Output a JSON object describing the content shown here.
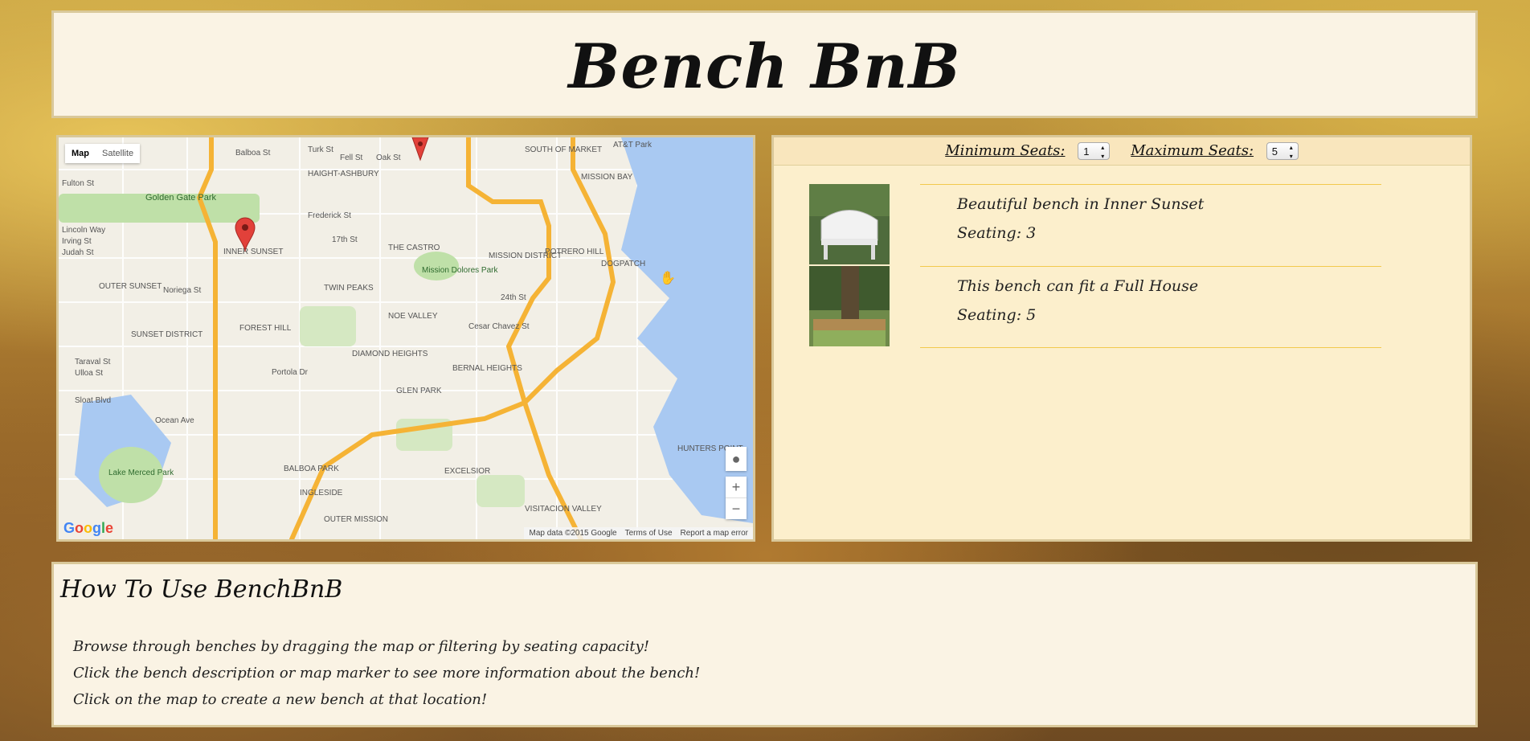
{
  "header": {
    "title": "Bench BnB"
  },
  "map": {
    "type_buttons": [
      "Map",
      "Satellite"
    ],
    "zoom_in": "+",
    "zoom_out": "−",
    "attribution": [
      "Map data ©2015 Google",
      "Terms of Use",
      "Report a map error"
    ],
    "logo": "Google",
    "labels": [
      "Balboa St",
      "Turk St",
      "Fulton St",
      "Golden Gate Park",
      "HAIGHT-ASHBURY",
      "Fell St",
      "Oak St",
      "Frederick St",
      "17th St",
      "Lincoln Way",
      "Irving St",
      "Judah St",
      "INNER SUNSET",
      "THE CASTRO",
      "MISSION DISTRICT",
      "POTRERO HILL",
      "DOGPATCH",
      "Mission Dolores Park",
      "OUTER SUNSET",
      "Noriega St",
      "TWIN PEAKS",
      "NOE VALLEY",
      "24th St",
      "Cesar Chavez St",
      "SUNSET DISTRICT",
      "FOREST HILL",
      "DIAMOND HEIGHTS",
      "BERNAL HEIGHTS",
      "Taraval St",
      "Ulloa St",
      "Portola Dr",
      "GLEN PARK",
      "Sloat Blvd",
      "Ocean Ave",
      "Lake Merced Park",
      "BALBOA PARK",
      "EXCELSIOR",
      "INGLESIDE",
      "OUTER MISSION",
      "VISITACION VALLEY",
      "HUNTERS POINT",
      "MISSION BAY",
      "SOUTH OF MARKET",
      "AT&T Park"
    ],
    "icon_names": [
      "map-pin-icon",
      "pegman-icon",
      "hand-cursor-icon"
    ]
  },
  "filters": {
    "min_label": "Minimum Seats:",
    "min_value": "1",
    "max_label": "Maximum Seats:",
    "max_value": "5"
  },
  "benches": [
    {
      "title": "Beautiful bench in Inner Sunset",
      "seating": "Seating: 3"
    },
    {
      "title": "This bench can fit a Full House",
      "seating": "Seating: 5"
    }
  ],
  "howto": {
    "title": "How To Use BenchBnB",
    "lines": [
      "Browse through benches by dragging the map or filtering by seating capacity!",
      "Click the bench description or map marker to see more information about the bench!",
      "Click on the map to create a new bench at that location!"
    ]
  },
  "colors": {
    "panel": "#faf3e4",
    "list_bg": "#fcefcc",
    "accent_line": "#f2c94c",
    "water": "#a9c9f2",
    "park": "#bfe0a8",
    "road": "#f5b335",
    "marker": "#e2413a"
  }
}
